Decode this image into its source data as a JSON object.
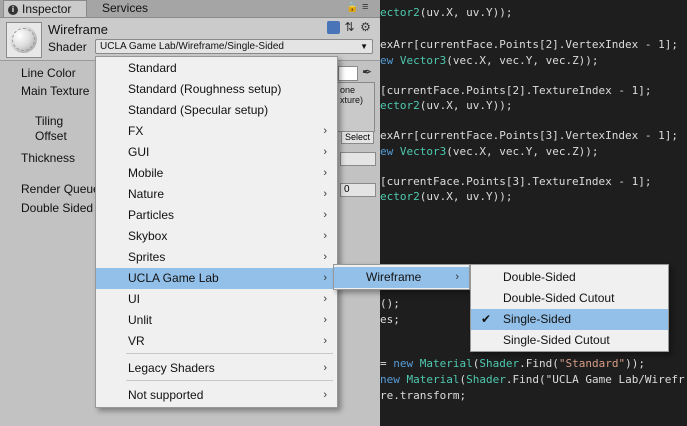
{
  "tabs": {
    "inspector": "Inspector",
    "services": "Services"
  },
  "material": {
    "name": "Wireframe",
    "shader_label": "Shader",
    "shader_value": "UCLA Game Lab/Wireframe/Single-Sided"
  },
  "properties": {
    "line_color": "Line Color",
    "main_texture": "Main Texture",
    "tiling": "Tiling",
    "offset": "Offset",
    "thickness": "Thickness",
    "render_queue": "Render Queue",
    "double_sided": "Double Sided",
    "texture_slot_text": "one\nxture)",
    "select_label": "Select",
    "render_queue_value": "0"
  },
  "menu_main": [
    {
      "label": "Standard",
      "submenu": false
    },
    {
      "label": "Standard (Roughness setup)",
      "submenu": false
    },
    {
      "label": "Standard (Specular setup)",
      "submenu": false
    },
    {
      "label": "FX",
      "submenu": true
    },
    {
      "label": "GUI",
      "submenu": true
    },
    {
      "label": "Mobile",
      "submenu": true
    },
    {
      "label": "Nature",
      "submenu": true
    },
    {
      "label": "Particles",
      "submenu": true
    },
    {
      "label": "Skybox",
      "submenu": true
    },
    {
      "label": "Sprites",
      "submenu": true
    },
    {
      "label": "UCLA Game Lab",
      "submenu": true,
      "highlighted": true
    },
    {
      "label": "UI",
      "submenu": true
    },
    {
      "label": "Unlit",
      "submenu": true
    },
    {
      "label": "VR",
      "submenu": true
    },
    {
      "label": "Legacy Shaders",
      "submenu": true
    },
    {
      "label": "Not supported",
      "submenu": true
    }
  ],
  "menu_sub1": [
    {
      "label": "Wireframe",
      "submenu": true,
      "highlighted": true
    }
  ],
  "menu_sub2": [
    {
      "label": "Double-Sided"
    },
    {
      "label": "Double-Sided Cutout"
    },
    {
      "label": "Single-Sided",
      "checked": true,
      "highlighted": true
    },
    {
      "label": "Single-Sided Cutout"
    }
  ],
  "code_lines": [
    "ector2(uv.X, uv.Y));",
    "",
    "exArr[currentFace.Points[2].VertexIndex - 1];",
    "ew Vector3(vec.X, vec.Y, vec.Z));",
    "",
    "[currentFace.Points[2].TextureIndex - 1];",
    "ector2(uv.X, uv.Y));",
    "",
    "exArr[currentFace.Points[3].VertexIndex - 1];",
    "ew Vector3(vec.X, vec.Y, vec.Z));",
    "",
    "[currentFace.Points[3].TextureIndex - 1];",
    "ector2(uv.X, uv.Y));",
    "();",
    "es;",
    "= new Material(Shader.Find(\"Standard\"));",
    "new Material(Shader.Find(\"UCLA Game Lab/Wirefr",
    "re.transform;"
  ],
  "icons": {
    "info": "info-icon",
    "lock": "lock-icon",
    "menu": "tab-menu-icon",
    "book": "help-book-icon",
    "sliders": "preset-sliders-icon",
    "gear": "gear-icon",
    "eyedropper": "eyedropper-icon",
    "chevron": "chevron-right-icon",
    "check": "checkmark-icon"
  }
}
